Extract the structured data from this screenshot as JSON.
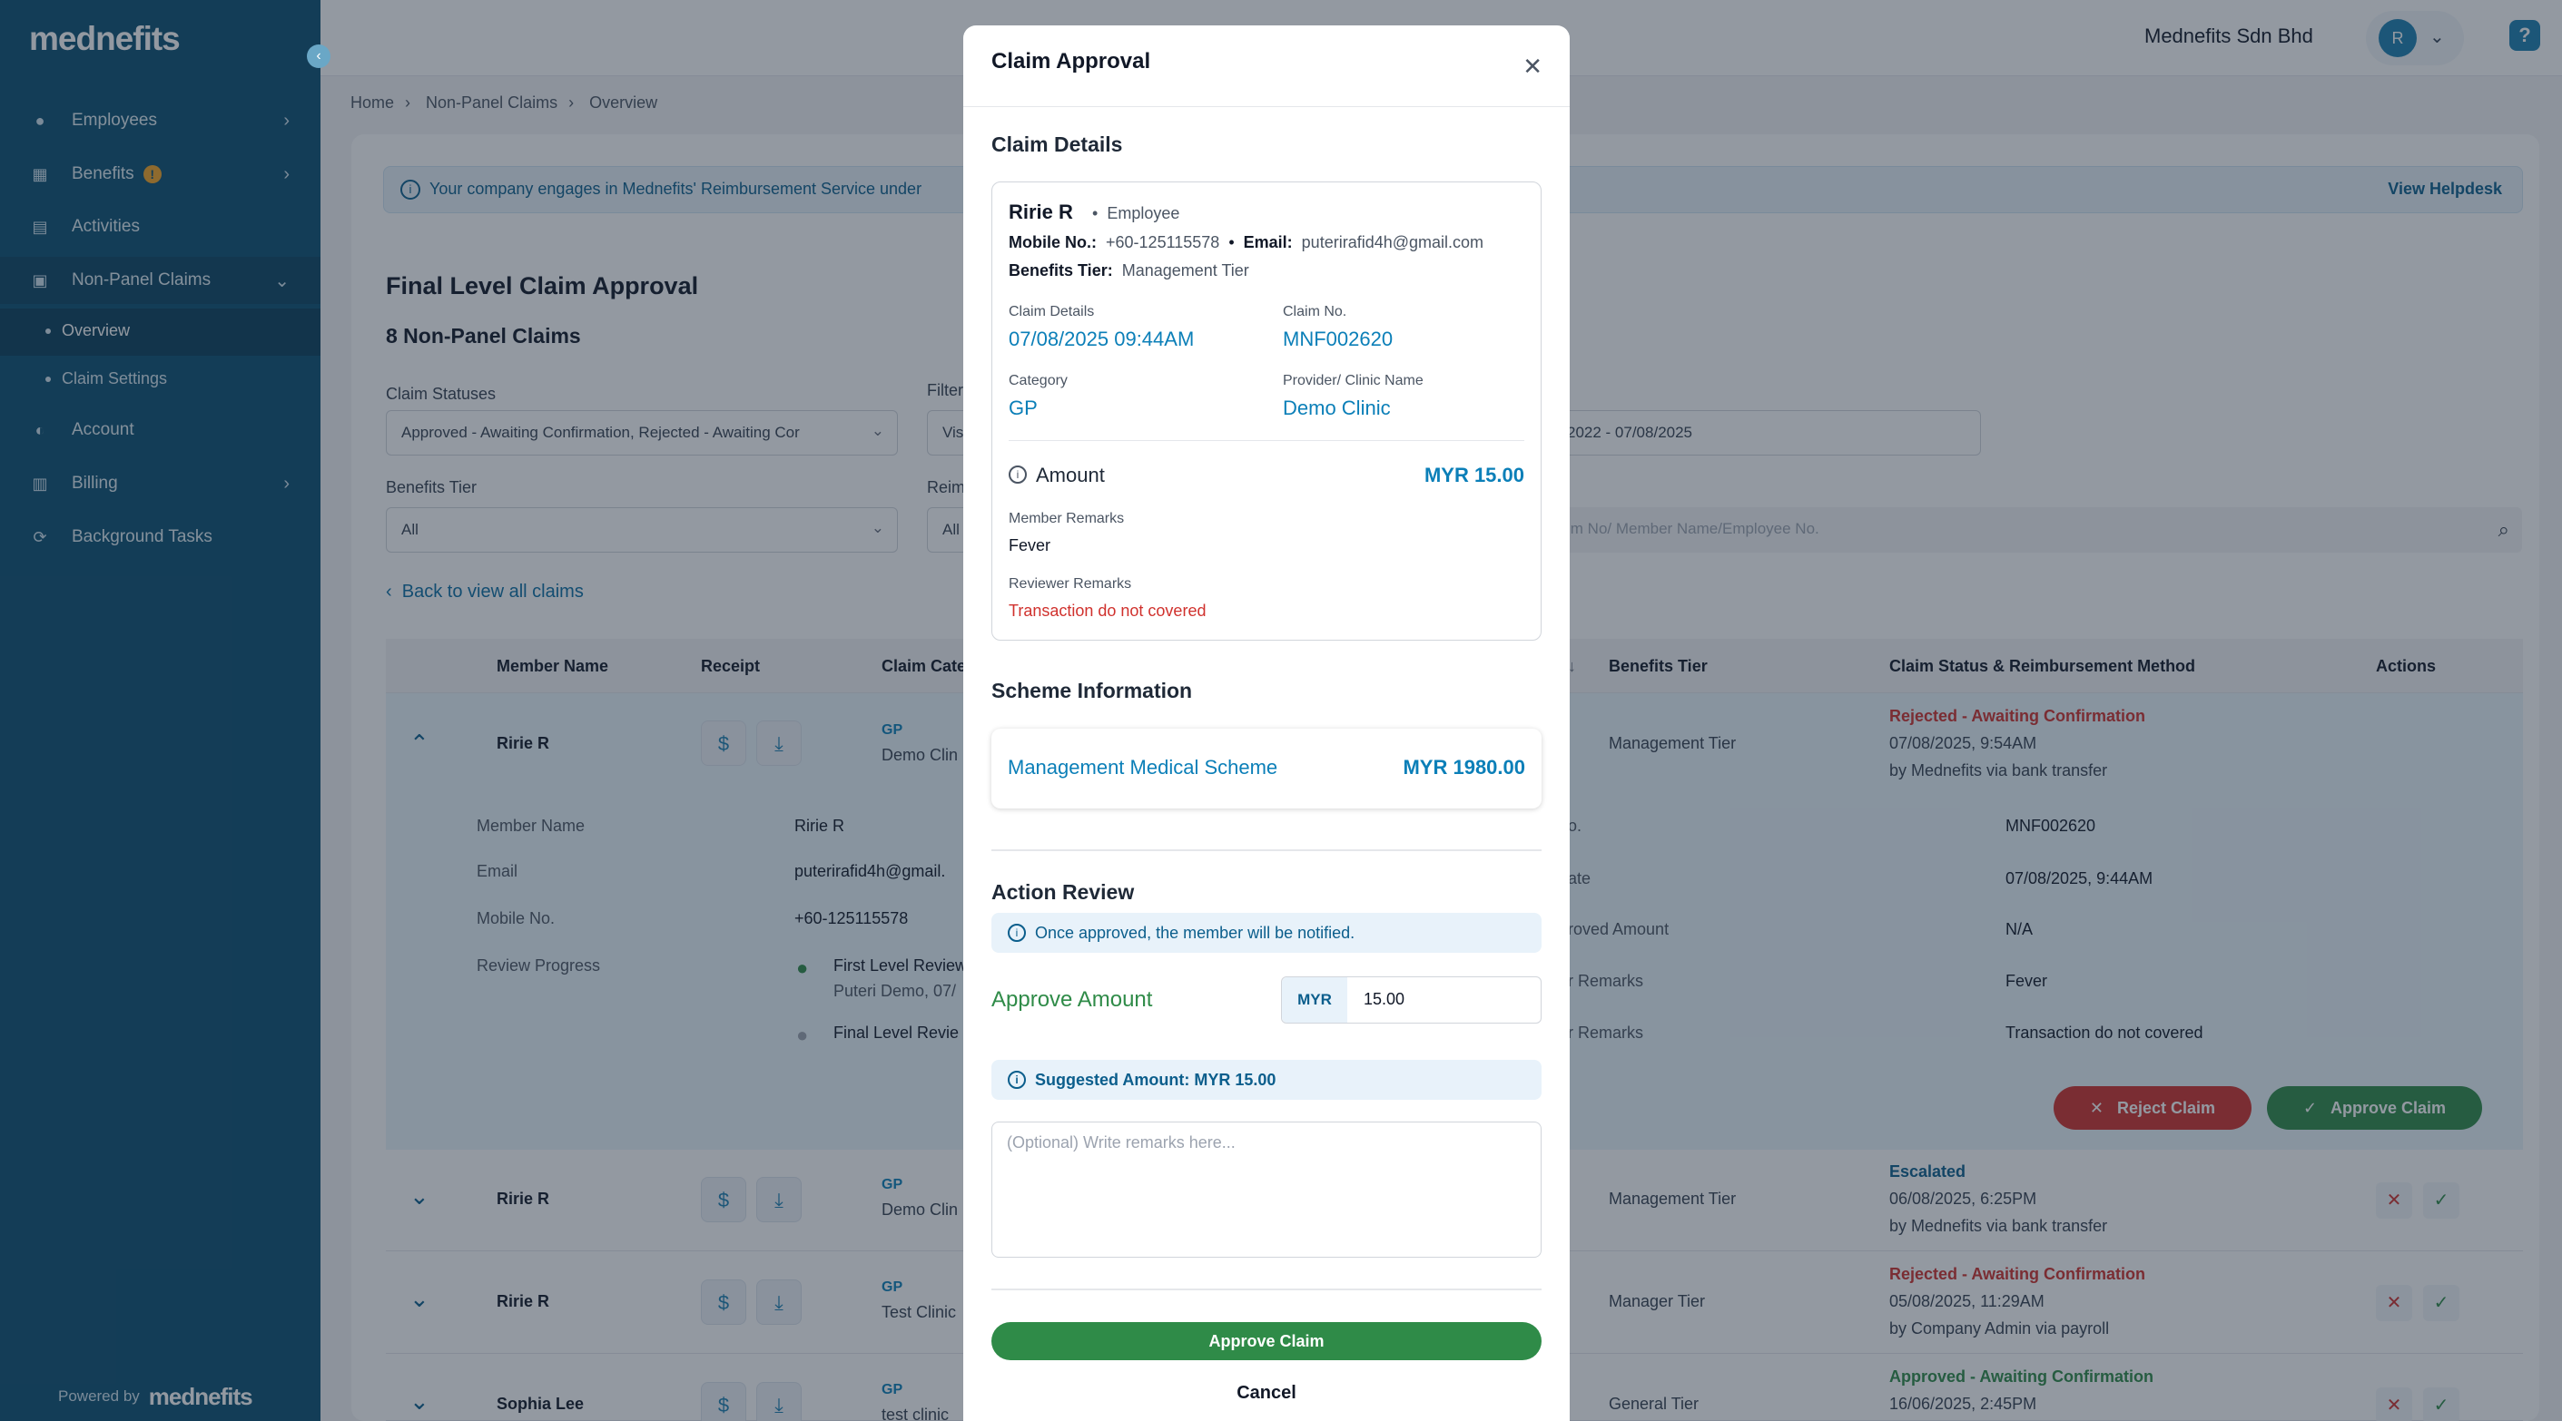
{
  "brand": {
    "logo": "mednefits",
    "powered_by": "Powered by",
    "powered_logo": "mednefits"
  },
  "sidebar": {
    "items": [
      {
        "label": "Employees",
        "icon": "person-icon"
      },
      {
        "label": "Benefits",
        "icon": "table-icon",
        "badge": "!"
      },
      {
        "label": "Activities",
        "icon": "book-icon"
      },
      {
        "label": "Non-Panel Claims",
        "icon": "money-icon"
      },
      {
        "label": "Account",
        "icon": "toggle-icon"
      },
      {
        "label": "Billing",
        "icon": "calculator-icon"
      },
      {
        "label": "Background Tasks",
        "icon": "sync-icon"
      }
    ],
    "subitems": [
      "Overview",
      "Claim Settings"
    ]
  },
  "topbar": {
    "company": "Mednefits Sdn Bhd",
    "avatar": "R",
    "help": "?"
  },
  "breadcrumb": [
    "Home",
    "Non-Panel Claims",
    "Overview"
  ],
  "notice": {
    "text": "Your company engages in Mednefits' Reimbursement Service under",
    "link": "View Helpdesk"
  },
  "page": {
    "title": "Final Level Claim Approval",
    "count": "8 Non-Panel Claims",
    "back": "Back to view all claims"
  },
  "filters": {
    "claim_statuses_label": "Claim Statuses",
    "claim_statuses_value": "Approved - Awaiting Confirmation, Rejected - Awaiting Cor",
    "filter_label": "Filter",
    "filter_value": "Vis",
    "date_value": "2022 - 07/08/2025",
    "benefits_tier_label": "Benefits Tier",
    "benefits_tier_value": "All",
    "reim_label": "Reim",
    "reim_value": "All",
    "search_placeholder": "im No/ Member Name/Employee No."
  },
  "table": {
    "headers": [
      "Member Name",
      "Receipt",
      "Claim Cate",
      "Benefits Tier",
      "Claim Status & Reimbursement Method",
      "Actions"
    ],
    "sort_icon": "↓",
    "rows": [
      {
        "name": "Ririe R",
        "cat": "GP",
        "clinic": "Demo Clin",
        "tier": "Management Tier",
        "status": "Rejected - Awaiting Confirmation",
        "date": "07/08/2025, 9:54AM",
        "by": "by Mednefits via bank transfer",
        "status_color": "#d0312d"
      },
      {
        "name": "Ririe R",
        "cat": "GP",
        "clinic": "Demo Clin",
        "tier": "Management Tier",
        "status": "Escalated",
        "date": "06/08/2025, 6:25PM",
        "by": "by Mednefits via bank transfer",
        "status_color": "#0b5e8c"
      },
      {
        "name": "Ririe R",
        "cat": "GP",
        "clinic": "Test Clinic",
        "tier": "Manager Tier",
        "status": "Rejected - Awaiting Confirmation",
        "date": "05/08/2025, 11:29AM",
        "by": "by Company Admin via payroll",
        "status_color": "#d0312d"
      },
      {
        "name": "Sophia Lee",
        "cat": "GP",
        "clinic": "test clinic",
        "tier": "General Tier",
        "status": "Approved - Awaiting Confirmation",
        "date": "16/06/2025, 2:45PM",
        "by": "",
        "status_color": "#2f8b48"
      }
    ]
  },
  "expanded": {
    "left": [
      [
        "Member Name",
        "Ririe R"
      ],
      [
        "Email",
        "puterirafid4h@gmail."
      ],
      [
        "Mobile No.",
        "+60-125115578"
      ],
      [
        "Review Progress",
        ""
      ]
    ],
    "progress": [
      {
        "t": "First Level Review",
        "s": "Puteri Demo, 07/"
      },
      {
        "t": "Final Level Revie",
        "s": ""
      }
    ],
    "right": [
      [
        "o.",
        "MNF002620"
      ],
      [
        "ate",
        "07/08/2025, 9:44AM"
      ],
      [
        "roved Amount",
        "N/A"
      ],
      [
        "r Remarks",
        "Fever"
      ],
      [
        "r Remarks",
        "Transaction do not covered"
      ]
    ],
    "reject": "Reject Claim",
    "approve": "Approve Claim"
  },
  "modal": {
    "title": "Claim Approval",
    "claim_details_heading": "Claim Details",
    "member": {
      "name": "Ririe R",
      "role": "Employee",
      "mobile_label": "Mobile No.:",
      "mobile": "+60-125115578",
      "email_label": "Email:",
      "email": "puterirafid4h@gmail.com",
      "tier_label": "Benefits Tier:",
      "tier": "Management Tier"
    },
    "fields": {
      "claim_details_label": "Claim Details",
      "claim_details_value": "07/08/2025 09:44AM",
      "claim_no_label": "Claim No.",
      "claim_no_value": "MNF002620",
      "category_label": "Category",
      "category_value": "GP",
      "provider_label": "Provider/ Clinic Name",
      "provider_value": "Demo Clinic"
    },
    "amount_label": "Amount",
    "amount_value": "MYR 15.00",
    "member_remarks_label": "Member Remarks",
    "member_remarks": "Fever",
    "reviewer_remarks_label": "Reviewer Remarks",
    "reviewer_remarks": "Transaction do not covered",
    "scheme_heading": "Scheme Information",
    "scheme_name": "Management Medical Scheme",
    "scheme_amount": "MYR 1980.00",
    "action_heading": "Action Review",
    "notify": "Once approved, the member will be notified.",
    "approve_amount_label": "Approve Amount",
    "currency": "MYR",
    "amount_input": "15.00",
    "suggested": "Suggested Amount: MYR 15.00",
    "remarks_placeholder": "(Optional) Write remarks here...",
    "approve_btn": "Approve Claim",
    "cancel_btn": "Cancel"
  },
  "colors": {
    "sidebar": "#0b4f71",
    "accent": "#0b7fb8",
    "green": "#2f8b48",
    "red": "#d0312d"
  }
}
